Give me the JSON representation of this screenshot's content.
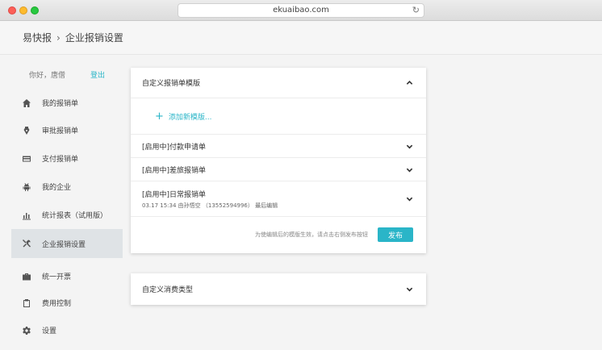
{
  "browser": {
    "url": "ekuaibao.com"
  },
  "header": {
    "brand": "易快报",
    "separator": "›",
    "page": "企业报销设置"
  },
  "sidebar": {
    "greeting": "你好，唐僧",
    "logout": "登出",
    "items": [
      {
        "label": "我的报销单",
        "icon": "home-icon"
      },
      {
        "label": "审批报销单",
        "icon": "pen-nib-icon"
      },
      {
        "label": "支付报销单",
        "icon": "credit-card-icon"
      },
      {
        "label": "我的企业",
        "icon": "robot-icon"
      },
      {
        "label": "统计报表（试用版）",
        "icon": "bar-chart-icon"
      },
      {
        "label": "企业报销设置",
        "icon": "tools-icon",
        "active": true
      },
      {
        "label": "统一开票",
        "icon": "briefcase-icon"
      },
      {
        "label": "费用控制",
        "icon": "clipboard-icon"
      },
      {
        "label": "设置",
        "icon": "gear-icon"
      }
    ]
  },
  "templates_card": {
    "title": "自定义报销单模版",
    "add_label": "添加新模版...",
    "templates": [
      {
        "name": "[启用中]付款申请单"
      },
      {
        "name": "[启用中]差旅报销单"
      },
      {
        "name": "[启用中]日常报销单",
        "meta": "03.17 15:34 由孙悟空 （13552594996） 最后编辑"
      }
    ],
    "hint": "为使编辑后的模版生效，请点击右侧发布按钮",
    "publish_label": "发布"
  },
  "expense_card": {
    "title": "自定义消费类型"
  },
  "colors": {
    "accent": "#2ab5c8",
    "active_bg": "#dfe3e6"
  }
}
